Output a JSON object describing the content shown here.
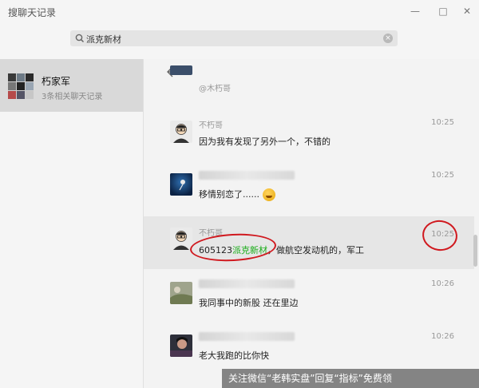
{
  "window": {
    "title": "搜聊天记录"
  },
  "search": {
    "value": "派克新材",
    "clear_glyph": "×"
  },
  "sidebar": {
    "contact": {
      "name": "朽家军",
      "subtitle": "3条相关聊天记录"
    }
  },
  "messages": [
    {
      "sender": "@木朽哥",
      "time": "",
      "text": ""
    },
    {
      "sender": "不朽哥",
      "time": "10:25",
      "text": "因为我有发现了另外一个，不错的"
    },
    {
      "sender": "",
      "time": "10:25",
      "text": "移情别恋了......"
    },
    {
      "sender": "不朽哥",
      "time": "10:25",
      "text_prefix": "605123",
      "text_highlight": "派克新材",
      "text_suffix": "，做航空发动机的，军工"
    },
    {
      "sender": "",
      "time": "10:26",
      "text": "我同事中的新股 还在里边"
    },
    {
      "sender": "",
      "time": "10:26",
      "text": "老大我跑的比你快"
    }
  ],
  "watermark": {
    "text": "关注微信“老韩实盘”回复“指标”免费领"
  },
  "colors": {
    "highlight": "#1aad19",
    "annotation": "#d0191f"
  }
}
